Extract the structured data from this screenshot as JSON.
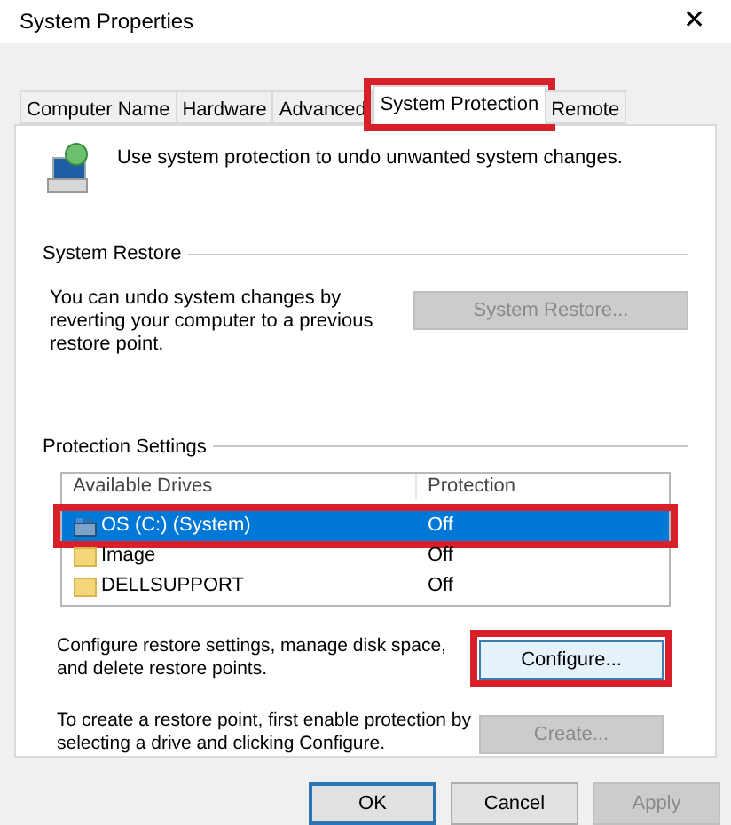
{
  "window": {
    "title": "System Properties",
    "close": "✕"
  },
  "tabs": [
    {
      "label": "Computer Name",
      "selected": false,
      "highlighted": false
    },
    {
      "label": "Hardware",
      "selected": false,
      "highlighted": false
    },
    {
      "label": "Advanced",
      "selected": false,
      "highlighted": false
    },
    {
      "label": "System Protection",
      "selected": true,
      "highlighted": true
    },
    {
      "label": "Remote",
      "selected": false,
      "highlighted": false
    }
  ],
  "intro": "Use system protection to undo unwanted system changes.",
  "system_restore": {
    "heading": "System Restore",
    "text": "You can undo system changes by reverting your computer to a previous restore point.",
    "button": {
      "label": "System Restore...",
      "disabled": true
    }
  },
  "protection_settings": {
    "heading": "Protection Settings",
    "columns": [
      "Available Drives",
      "Protection"
    ],
    "rows": [
      {
        "kind": "system",
        "drive": "OS (C:) (System)",
        "protection": "Off",
        "selected": true,
        "highlighted": true
      },
      {
        "kind": "folder",
        "drive": "Image",
        "protection": "Off",
        "selected": false,
        "highlighted": false
      },
      {
        "kind": "folder",
        "drive": "DELLSUPPORT",
        "protection": "Off",
        "selected": false,
        "highlighted": false
      }
    ],
    "configure": {
      "text": "Configure restore settings, manage disk space, and delete restore points.",
      "button": {
        "label": "Configure...",
        "disabled": false,
        "highlighted": true
      }
    },
    "create": {
      "text": "To create a restore point, first enable protection by selecting a drive and clicking Configure.",
      "button": {
        "label": "Create...",
        "disabled": true
      }
    }
  },
  "buttons": [
    {
      "label": "OK",
      "disabled": false,
      "default": true
    },
    {
      "label": "Cancel",
      "disabled": false,
      "default": false
    },
    {
      "label": "Apply",
      "disabled": true,
      "default": false
    }
  ]
}
